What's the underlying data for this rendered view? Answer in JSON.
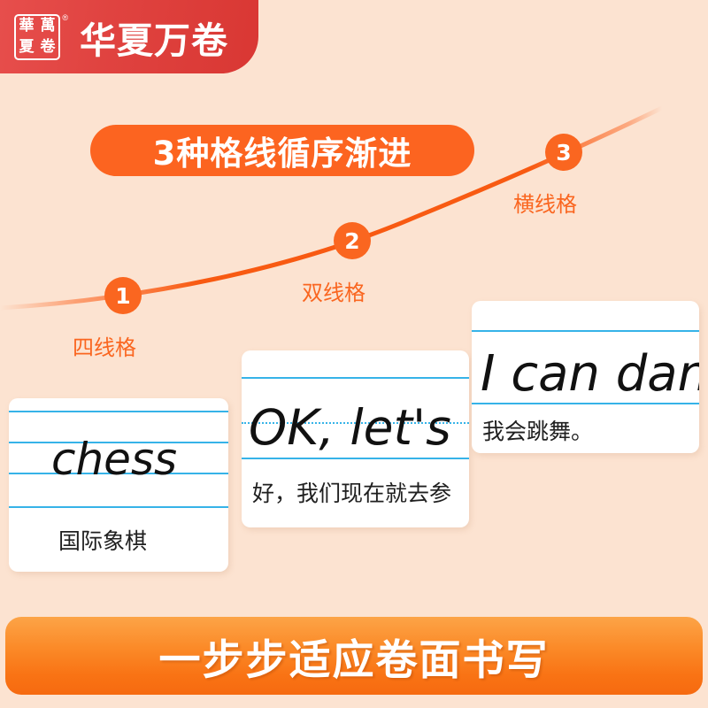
{
  "page": {
    "background_color": "#fce3d1",
    "accent_orange": "#fa6620",
    "brand_red": "#e04340",
    "rule_blue": "#36b3e8"
  },
  "header": {
    "brand_name": "华夏万卷",
    "registered_mark": "®",
    "seal_characters": [
      "萬",
      "華",
      "卷",
      "夏"
    ]
  },
  "title": {
    "text": "3种格线循序渐进"
  },
  "steps": [
    {
      "number": "1",
      "label": "四线格"
    },
    {
      "number": "2",
      "label": "双线格"
    },
    {
      "number": "3",
      "label": "横线格"
    }
  ],
  "cards": [
    {
      "grid_type": "four-line",
      "english": "chess",
      "chinese": "国际象棋"
    },
    {
      "grid_type": "double-line",
      "english": "OK, let's",
      "chinese": "好，我们现在就去参"
    },
    {
      "grid_type": "horizontal-line",
      "english": "I can dan",
      "chinese": "我会跳舞。"
    }
  ],
  "footer": {
    "text": "一步步适应卷面书写"
  }
}
